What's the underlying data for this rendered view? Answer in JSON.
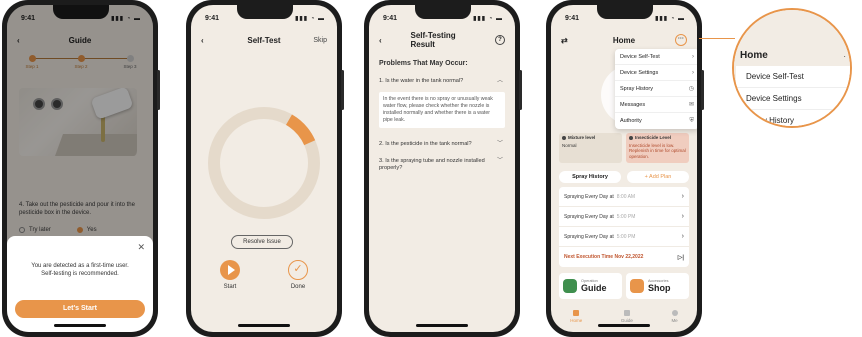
{
  "phones": {
    "guide": {
      "status_time": "9:41",
      "title": "Guide",
      "steps": [
        "Step 1",
        "Step 2",
        "Step 3"
      ],
      "instruction": "4. Take out the pesticide and pour it into the pesticide box in the device.",
      "radio_options": [
        "Try later",
        "Yes"
      ],
      "sheet_message_line1": "You are detected as a first-time user.",
      "sheet_message_line2": "Self-testing is recommended.",
      "start_button": "Let's Start",
      "close_glyph": "✕",
      "back_glyph": "‹"
    },
    "self_test": {
      "status_time": "9:41",
      "title": "Self-Test",
      "skip": "Skip",
      "back_glyph": "‹",
      "progress_fraction": 0.1,
      "resolve_button": "Resolve Issue",
      "start_label": "Start",
      "done_label": "Done",
      "done_glyph": "✓",
      "colors": {
        "accent": "#e8954a",
        "ring_track": "#e5dacb"
      }
    },
    "result": {
      "status_time": "9:41",
      "title": "Self-Testing Result",
      "help_glyph": "?",
      "back_glyph": "‹",
      "heading": "Problems That May Occur:",
      "questions": [
        {
          "text": "1. Is the water in the tank normal?",
          "chevron": "︿"
        },
        {
          "text": "2. Is the pesticide in the tank normal?",
          "chevron": "﹀"
        },
        {
          "text": "3. Is the spraying tube and nozzle installed properly?",
          "chevron": "﹀"
        }
      ],
      "answer": "In the event there is no spray or unusually weak water flow, please check whether the nozzle is installed normally and whether there is a water pipe leak."
    },
    "home": {
      "status_time": "9:41",
      "title": "Home",
      "swap_glyph": "⇄",
      "menu_glyph": "···",
      "menu_items": [
        {
          "label": "Device Self-Test",
          "icon": "›"
        },
        {
          "label": "Device Settings",
          "icon": "›"
        },
        {
          "label": "Spray History",
          "icon": "◷"
        },
        {
          "label": "Messages",
          "icon": "✉"
        },
        {
          "label": "Authority",
          "icon": "⛨"
        }
      ],
      "mixture_level": {
        "title": "Mixture level",
        "value": "Normal"
      },
      "insecticide_level": {
        "title": "Insecticide Level",
        "value": "Insecticide level is low. Replenish in time for optimal operation."
      },
      "tabs": [
        "Spray History",
        "+ Add Plan"
      ],
      "plans": [
        {
          "label": "Spraying Every Day at",
          "time": "8:00 AM"
        },
        {
          "label": "Spraying Every Day at",
          "time": "5:00 PM"
        },
        {
          "label": "Spraying Every Day at",
          "time": "5:00 PM"
        }
      ],
      "next_execution": "Next Execution Time Nov 22,2022",
      "cards": [
        {
          "small": "Operation",
          "big": "Guide"
        },
        {
          "small": "Accessories",
          "big": "Shop"
        }
      ],
      "bottom_nav": [
        "Home",
        "Guide",
        "Me"
      ]
    }
  },
  "zoom": {
    "title": "Home",
    "items": [
      "Device Self-Test",
      "Device Settings",
      "Spray History"
    ],
    "chevron": "›",
    "dots": "·"
  }
}
